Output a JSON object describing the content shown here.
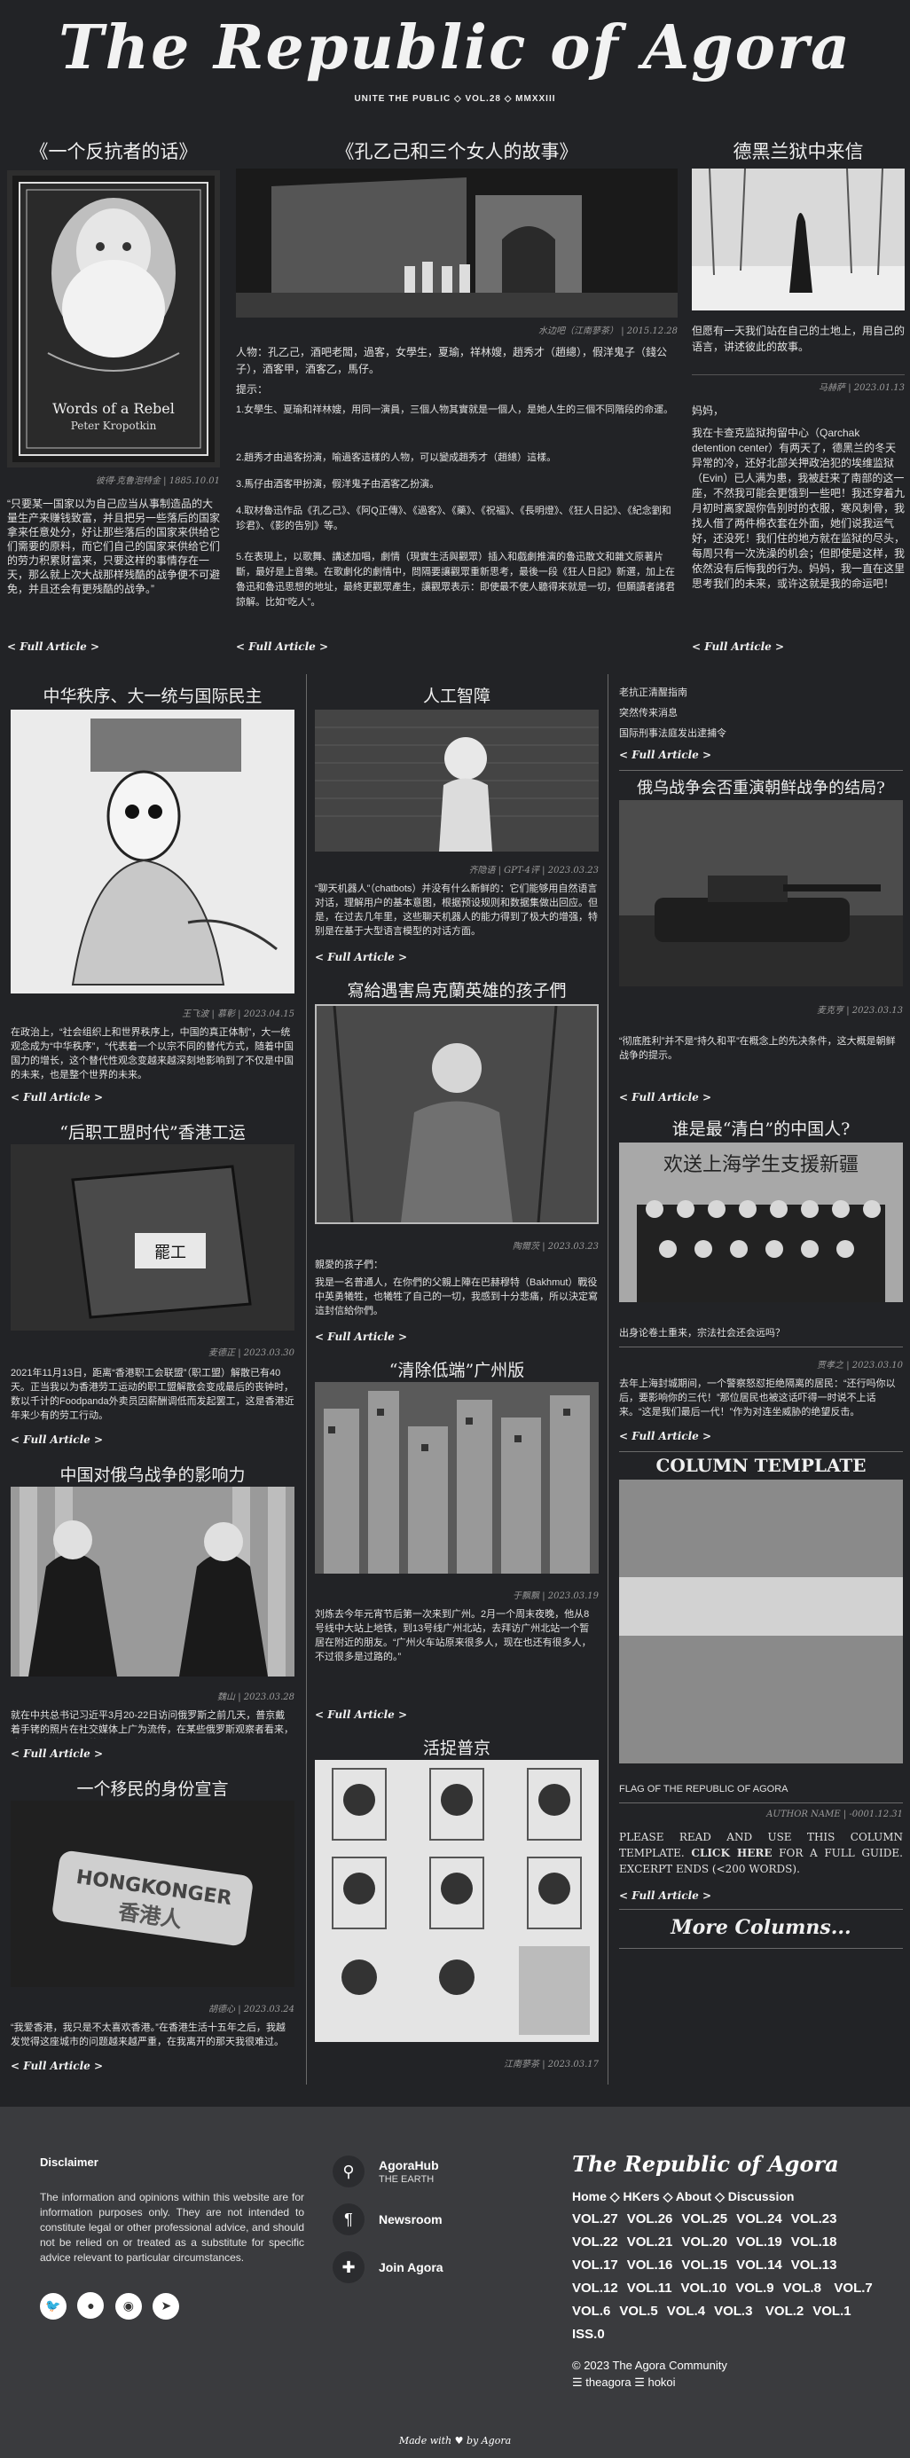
{
  "site": {
    "title": "The Republic of Agora",
    "subtitle": "UNITE THE PUBLIC ◇ VOL.28 ◇ MMXXIII"
  },
  "more_label": "< Full Article >",
  "top": {
    "left": {
      "title": "《一个反抗者的话》",
      "image_text_1": "Words of a Rebel",
      "image_text_2": "Peter Kropotkin",
      "caption": "彼得·克鲁泡特金 | 1885.10.01",
      "text": "“只要某一国家以为自己应当从事制造品的大量生产来赚钱致富，并且把另一些落后的国家拿来任意处分，好让那些落后的国家来供给它们需要的原料，而它们自己的国家来供给它们的劳力积累财富来，只要这样的事情存在一天，那么就上次大战那样残酷的战争便不可避免，并且还会有更残酷的战争。”"
    },
    "center": {
      "title": "《孔乙己和三个女人的故事》",
      "caption": "水边吧（江南蓼茶） | 2015.12.28",
      "intro": "人物：孔乙己，酒吧老闆，過客，女學生，夏瑜，祥林嫂，趙秀才（趙總），假洋鬼子（錢公子），酒客甲，酒客乙，馬仔。",
      "hint_label": "提示：",
      "items": [
        "1.女學生、夏瑜和祥林嫂，用同一演員，三個人物其實就是一個人，是她人生的三個不同階段的命運。",
        "2.趙秀才由過客扮演，喻過客這樣的人物，可以變成趙秀才（趙總）這樣。",
        "3.馬仔由酒客甲扮演，假洋鬼子由酒客乙扮演。",
        "4.取材魯迅作品《孔乙己》、《阿Q正傳》、《過客》、《藥》、《祝福》、《長明燈》、《狂人日記》、《紀念劉和珍君》、《影的告別》等。",
        "5.在表現上，以歌舞、講述加唱，劇情（現實生活與觀眾）插入和戲劇推演的魯迅散文和雜文原著片斷，最好是上音樂。在歌劇化的劇情中，問隔要讓觀眾重新思考，最後一段《狂人日記》新選，加上在魯迅和魯迅思想的地址，最終更觀眾產生，讓觀眾表示：即使最不使人聽得來就是一切，但願讀者諸君諒解。比如“吃人”。"
      ]
    },
    "right": {
      "title": "德黑兰狱中来信",
      "lead": "但愿有一天我们站在自己的土地上，用自己的语言，讲述彼此的故事。",
      "caption": "马赫萨 | 2023.01.13",
      "text1": "妈妈，",
      "text2": "我在卡查克监狱拘留中心（Qarchak detention center）有两天了，德黑兰的冬天异常的冷，还好北部关押政治犯的埃维监狱（Evin）已人满为患，我被赶来了南部的这一座，不然我可能会更饿到一些吧！我还穿着九月初时离家跟你告别时的衣服，寒风刺骨，我找人借了两件棉衣套在外面，她们说我运气好，还没死！我们住的地方就在监狱的尽头，每周只有一次洗澡的机会；但即使是这样，我依然没有后悔我的行为。妈妈，我一直在这里思考我们的未来，或许这就是我的命运吧！"
    }
  },
  "mid_left": [
    {
      "title": "中华秩序、大一统与国际民主",
      "caption": "王飞波 | 慕彰 | 2023.04.15",
      "text": "在政治上，“社会组织上和世界秩序上，中国的真正体制”，大一统观念成为“中华秩序”，“代表着一个以宗不同的替代方式，随着中国国力的增长，这个替代性观念变越来越深刻地影响到了不仅是中国的未来，也是整个世界的未来。"
    },
    {
      "title": "“后职工盟时代”香港工运",
      "caption": "麦德正 | 2023.03.30",
      "text": "2021年11月13日，距离“香港职工会联盟”（职工盟）解散已有40天。正当我以为香港劳工运动的职工盟解散会变成最后的丧钟时，数以千计的Foodpanda外卖员因薪酬调低而发起罢工，这是香港近年来少有的劳工行动。"
    },
    {
      "title": "中国对俄乌战争的影响力",
      "caption": "魏山 | 2023.03.28",
      "text": "就在中共总书记习近平3月20-22日访问俄罗斯之前几天，普京戴着手铐的照片在社交媒体上广为流传，在某些俄罗斯观察者看来，这是一次对习近平的羞辱。"
    },
    {
      "title": "一个移民的身份宣言",
      "badge_text": "HONGKONGER",
      "badge_sub": "香港人",
      "caption": "胡德心 | 2023.03.24",
      "text": "“我爱香港，我只是不太喜欢香港。”在香港生活十五年之后，我越发觉得这座城市的问题越来越严重，在我离开的那天我很难过。"
    }
  ],
  "mid_center": [
    {
      "title": "人工智障",
      "caption": "齐隐语 | GPT-4评 | 2023.03.23",
      "text": "“聊天机器人”（chatbots）并没有什么新鲜的：它们能够用自然语言对话，理解用户的基本意图，根据预设规则和数据集做出回应。但是，在过去几年里，这些聊天机器人的能力得到了极大的增强，特别是在基于大型语言模型的对话方面。"
    },
    {
      "title": "寫給遇害烏克蘭英雄的孩子們",
      "caption": "陶爾茨 | 2023.03.23",
      "text1": "親愛的孩子們：",
      "text2": "我是一名普通人，在你們的父親上陣在巴赫穆特（Bakhmut）戰役中英勇犧牲，也犧牲了自己的一切，我感到十分悲痛，所以決定寫這封信給你們。"
    },
    {
      "title": "“清除低端”广州版",
      "caption": "于飘飘 | 2023.03.19",
      "text": "刘炼去今年元宵节后第一次来到广州。2月一个周末夜晚，他从8号线中大站上地铁，到13号线广州北站，去拜访广州北站一个暂居在附近的朋友。“广州火车站原来很多人，现在也还有很多人，不过很多是过路的。”"
    },
    {
      "title": "活捉普京",
      "caption": "江南蓼茶 | 2023.03.17"
    }
  ],
  "mid_right": {
    "links": [
      "老抗正清醒指南",
      "突然传来消息",
      "国际刑事法庭发出逮捕令"
    ],
    "articles": [
      {
        "title": "俄乌战争会否重演朝鲜战争的结局?",
        "caption": "麦克亨 | 2023.03.13",
        "text": "“彻底胜利”并不是“持久和平”在概念上的先决条件，这大概是朝鲜战争的提示。"
      },
      {
        "title": "谁是最“清白”的中国人?",
        "image_text": "欢送上海学生支援新疆",
        "caption": "贾孝之 | 2023.03.10",
        "text1": "出身论卷土重来，宗法社会还会远吗？",
        "text2": "去年上海封城期间，一个警察怒怼拒绝隔离的居民：“还行吗你以后，要影响你的三代！”那位居民也被这话吓得一时说不上话来。“这是我们最后一代！”作为对连坐威胁的绝望反击。"
      }
    ],
    "template": {
      "title": "COLUMN TEMPLATE",
      "flag": "FLAG OF THE REPUBLIC OF AGORA",
      "caption": "AUTHOR NAME | -0001.12.31",
      "text_a": "PLEASE READ AND USE THIS COLUMN TEMPLATE.",
      "text_b": "CLICK HERE",
      "text_c": "FOR A FULL GUIDE. EXCERPT ENDS (<200 WORDS).",
      "more_columns": "More Columns..."
    }
  },
  "footer": {
    "disclaimer_title": "Disclaimer",
    "disclaimer": "The information and opinions within this website are for information purposes only. They are not intended to constitute legal or other professional advice, and should not be relied on or treated as a substitute for specific advice relevant to particular circumstances.",
    "social": [
      "twitter-icon",
      "github-icon",
      "reddit-icon",
      "telegram-icon"
    ],
    "links": [
      {
        "label": "AgoraHub",
        "sub": "THE EARTH",
        "icon": "location-pin-icon"
      },
      {
        "label": "Newsroom",
        "sub": "",
        "icon": "paragraph-icon"
      },
      {
        "label": "Join Agora",
        "sub": "",
        "icon": "puzzle-icon"
      }
    ],
    "brand": "The Republic of Agora",
    "nav": [
      "Home",
      "HKers",
      "About",
      "Discussion"
    ],
    "nav_sep": "◇",
    "volumes": [
      "VOL.27",
      "VOL.26",
      "VOL.25",
      "VOL.24",
      "VOL.23",
      "VOL.22",
      "VOL.21",
      "VOL.20",
      "VOL.19",
      "VOL.18",
      "VOL.17",
      "VOL.16",
      "VOL.15",
      "VOL.14",
      "VOL.13",
      "VOL.12",
      "VOL.11",
      "VOL.10",
      "VOL.9",
      "VOL.8",
      "VOL.7",
      "VOL.6",
      "VOL.5",
      "VOL.4",
      "VOL.3",
      "VOL.2",
      "VOL.1",
      "ISS.0"
    ],
    "copyright": "© 2023 The Agora Community",
    "handles": "☰ theagora ☰ hokoi",
    "made_with": "Made with ♥ by Agora"
  }
}
